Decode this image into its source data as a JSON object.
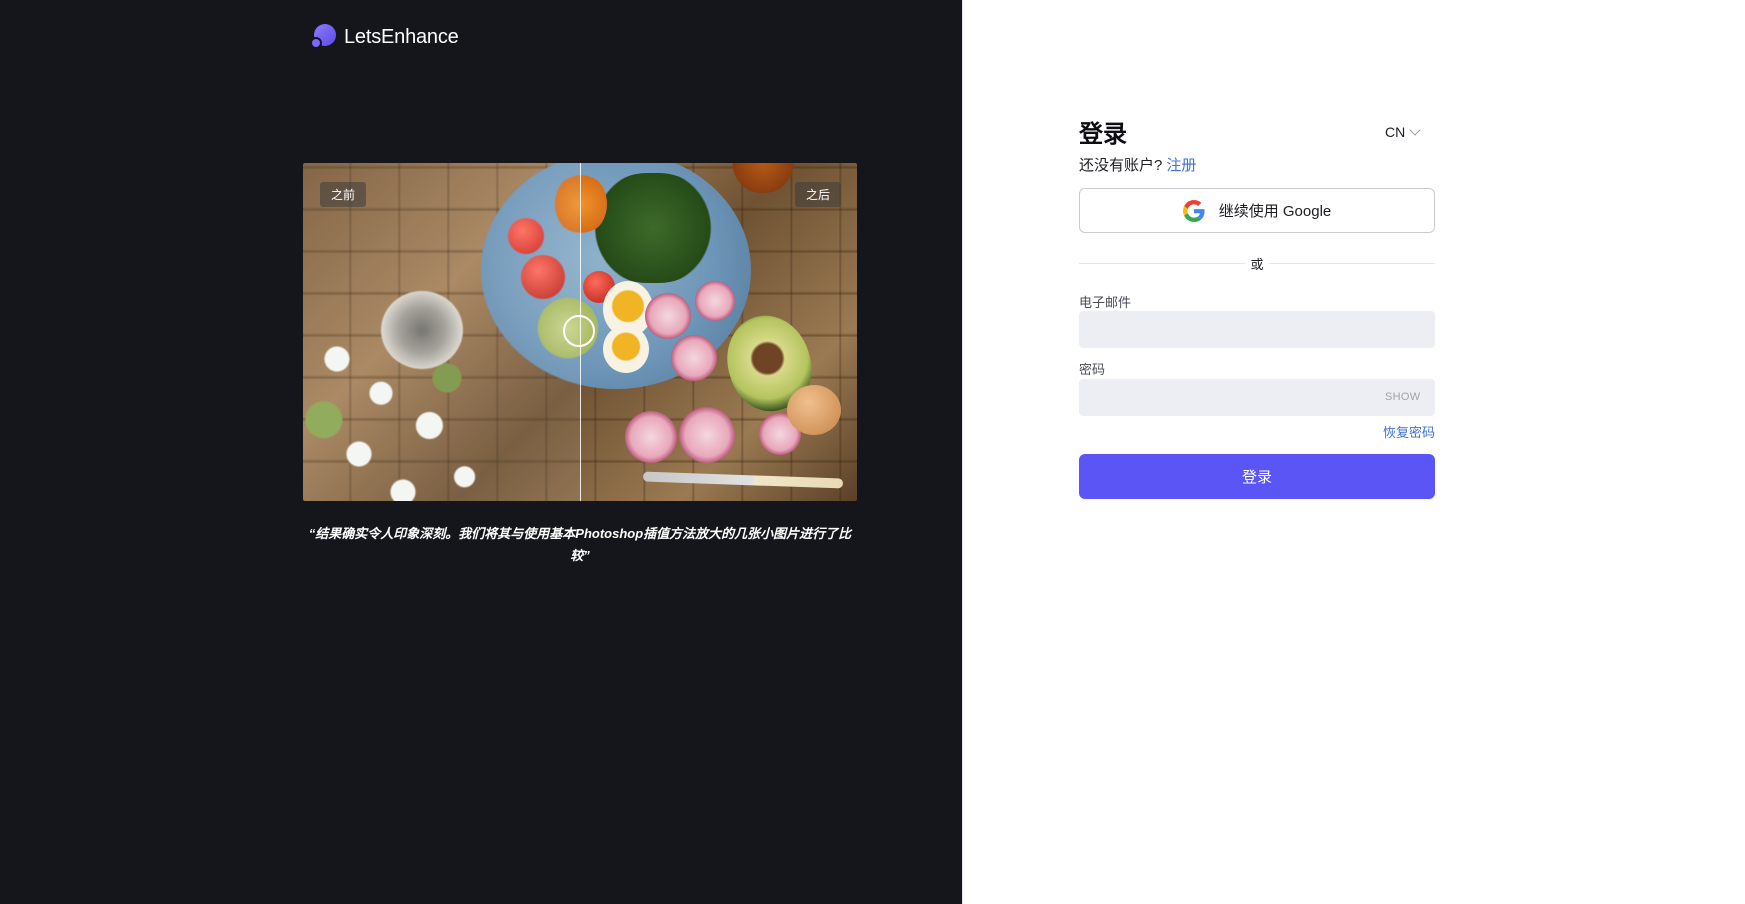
{
  "brand": {
    "name": "LetsEnhance"
  },
  "showcase": {
    "before_label": "之前",
    "after_label": "之后",
    "quote": "“结果确实令人印象深刻。我们将其与使用基本Photoshop插值方法放大的几张小图片进行了比较”"
  },
  "login": {
    "title": "登录",
    "language": "CN",
    "no_account_text": "还没有账户?",
    "signup_link": "注册",
    "google_button": "继续使用 Google",
    "or_text": "或",
    "email_label": "电子邮件",
    "email_value": "",
    "password_label": "密码",
    "password_value": "",
    "show_button": "SHOW",
    "forgot_link": "恢复密码",
    "submit_button": "登录"
  },
  "colors": {
    "left_bg": "#15161b",
    "primary": "#5b55f5",
    "link": "#3f6fd8",
    "input_bg": "#eceef3"
  }
}
